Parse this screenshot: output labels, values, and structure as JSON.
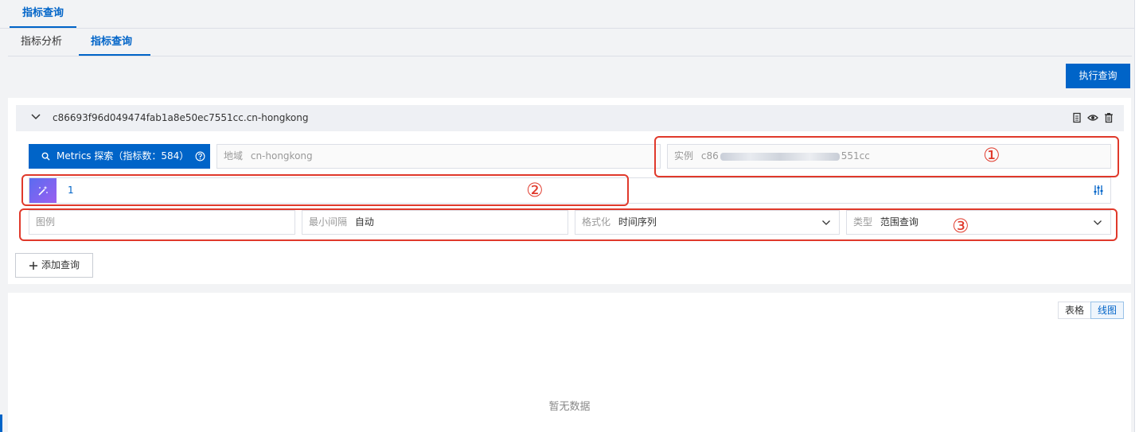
{
  "top_tab": {
    "label": "指标查询"
  },
  "sub_tabs": [
    {
      "label": "指标分析"
    },
    {
      "label": "指标查询"
    }
  ],
  "toolbar": {
    "execute_label": "执行查询"
  },
  "query": {
    "title": "c86693f96d049474fab1a8e50ec7551cc.cn-hongkong",
    "metrics_button": "Metrics 探索（指标数：584）",
    "region": {
      "label": "地域",
      "value": "cn-hongkong"
    },
    "instance": {
      "label": "实例",
      "value_start": "c86",
      "value_end": "551cc"
    },
    "expression": "1",
    "legend": {
      "placeholder": "图例"
    },
    "step": {
      "label": "最小间隔",
      "value": "自动"
    },
    "format": {
      "label": "格式化",
      "value": "时间序列"
    },
    "type": {
      "label": "类型",
      "value": "范围查询"
    },
    "add_label": "添加查询"
  },
  "annotations": [
    "①",
    "②",
    "③"
  ],
  "result": {
    "views": [
      {
        "label": "表格"
      },
      {
        "label": "线图"
      }
    ],
    "empty_text": "暂无数据"
  },
  "colors": {
    "primary": "#0064c8",
    "annotation": "#e0392b",
    "background": "#f2f3f5"
  }
}
